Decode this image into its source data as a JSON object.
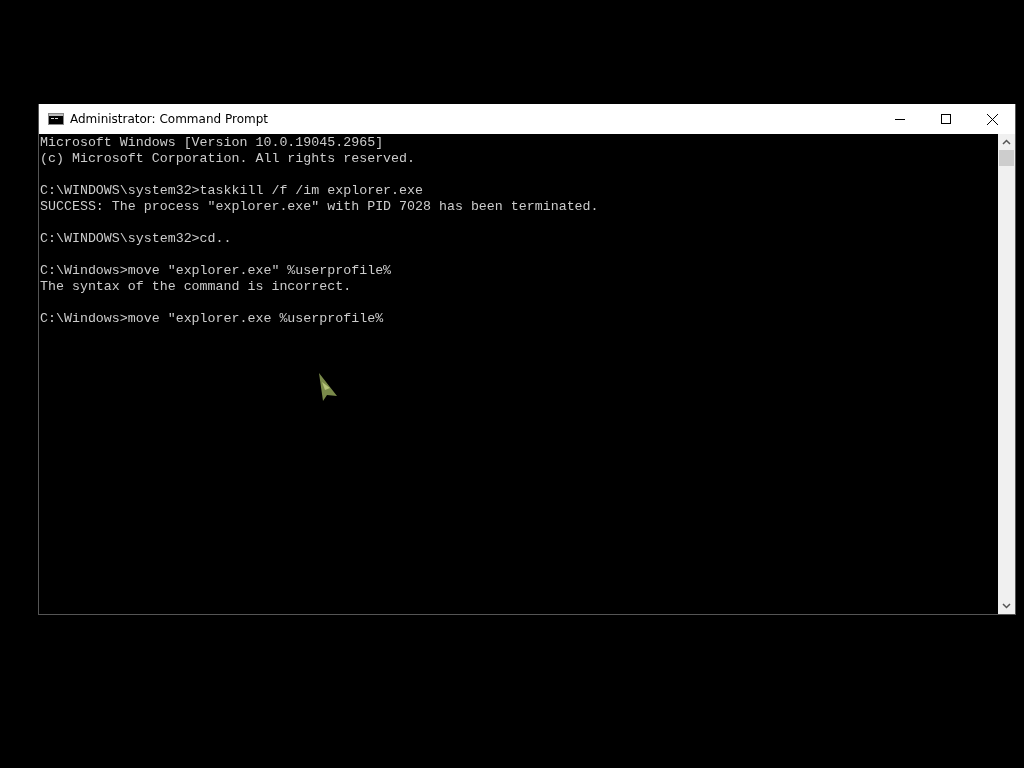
{
  "window": {
    "title": "Administrator: Command Prompt"
  },
  "console": {
    "lines": [
      {
        "kind": "text",
        "text": "Microsoft Windows [Version 10.0.19045.2965]"
      },
      {
        "kind": "text",
        "text": "(c) Microsoft Corporation. All rights reserved."
      },
      {
        "kind": "blank"
      },
      {
        "kind": "text",
        "text": "C:\\WINDOWS\\system32>taskkill /f /im explorer.exe"
      },
      {
        "kind": "text",
        "text": "SUCCESS: The process \"explorer.exe\" with PID 7028 has been terminated."
      },
      {
        "kind": "blank"
      },
      {
        "kind": "text",
        "text": "C:\\WINDOWS\\system32>cd.."
      },
      {
        "kind": "blank"
      },
      {
        "kind": "text",
        "text": "C:\\Windows>move \"explorer.exe\" %userprofile%"
      },
      {
        "kind": "text",
        "text": "The syntax of the command is incorrect."
      },
      {
        "kind": "blank"
      },
      {
        "kind": "text",
        "text": "C:\\Windows>move \"explorer.exe %userprofile%"
      }
    ]
  }
}
